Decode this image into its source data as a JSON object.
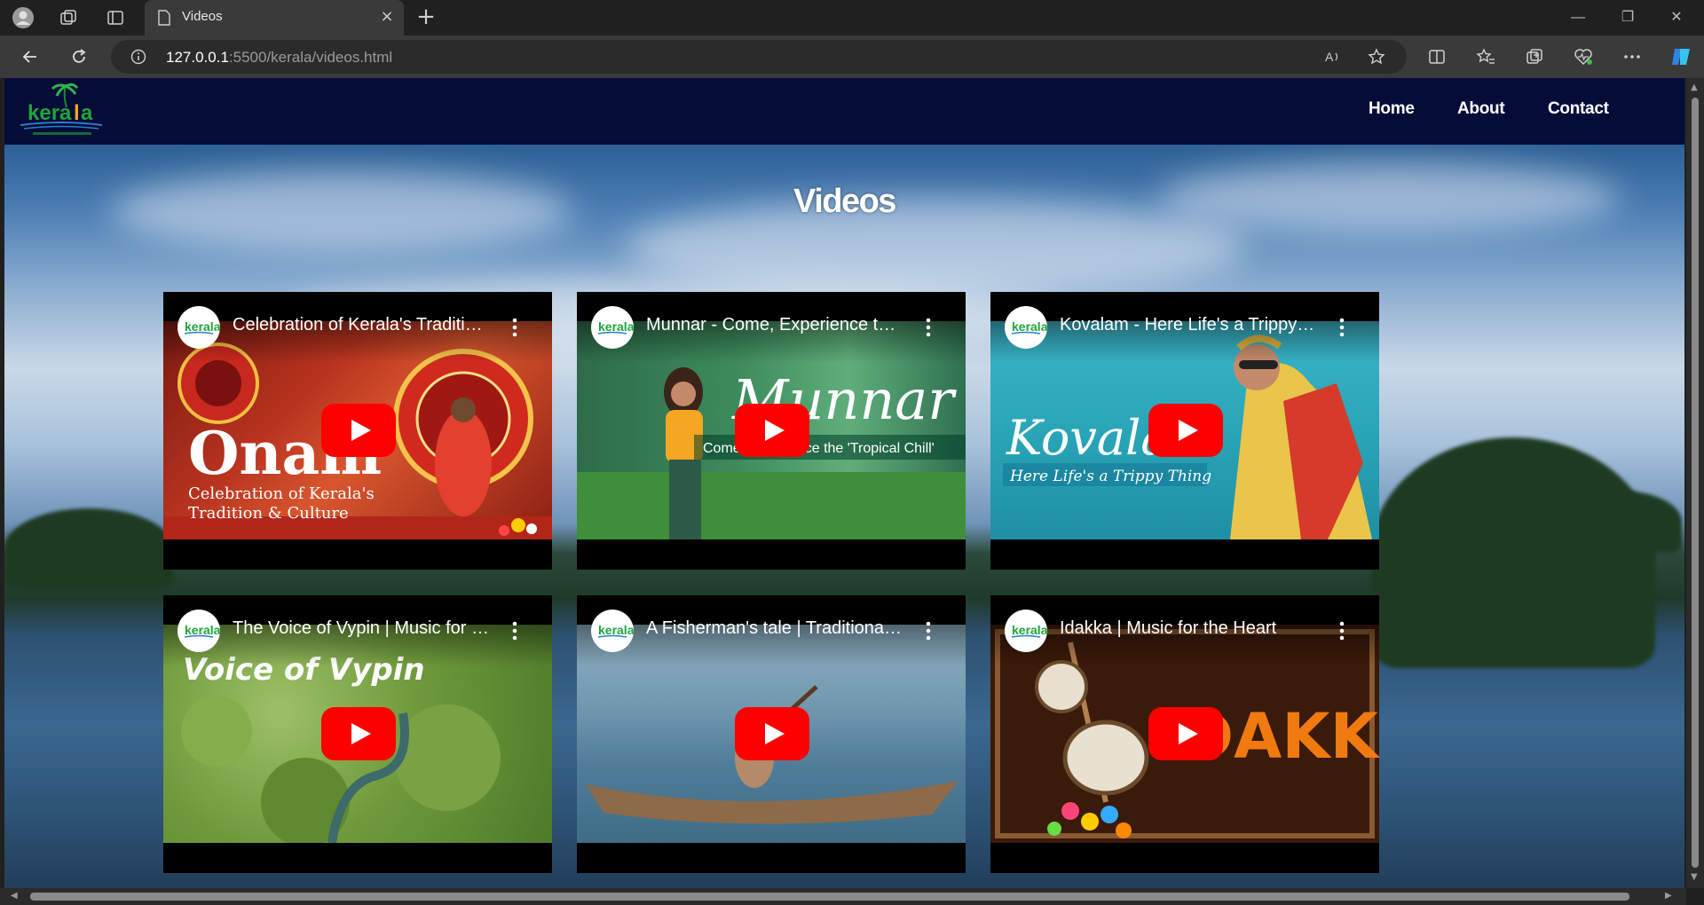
{
  "browser": {
    "tab_title": "Videos",
    "url_host": "127.0.0.1",
    "url_rest": ":5500/kerala/videos.html"
  },
  "site": {
    "nav": [
      "Home",
      "About",
      "Contact"
    ],
    "page_title": "Videos"
  },
  "videos": [
    {
      "title": "Celebration of Kerala's Tradition & Culture",
      "overlay_big": "Onam",
      "overlay_sub": "Celebration of Kerala's\nTradition & Culture"
    },
    {
      "title": "Munnar - Come, Experience the 'Tropical Chill'",
      "overlay_big": "Munnar",
      "overlay_sub": "Come, Experience the 'Tropical Chill'"
    },
    {
      "title": "Kovalam - Here Life's a Trippy Thing",
      "overlay_big": "Kovalam",
      "overlay_sub": "Here Life's a Trippy Thing"
    },
    {
      "title": "The Voice of Vypin | Music for the Soul",
      "overlay_big": "Voice of Vypin",
      "overlay_sub": ""
    },
    {
      "title": "A Fisherman's tale | Traditional Kerala",
      "overlay_big": "",
      "overlay_sub": ""
    },
    {
      "title": "Idakka | Music for the Heart",
      "overlay_big": "IDAKKA",
      "overlay_sub": ""
    }
  ],
  "colors": {
    "navbar": "#060c38",
    "play_red": "#ff0000"
  }
}
